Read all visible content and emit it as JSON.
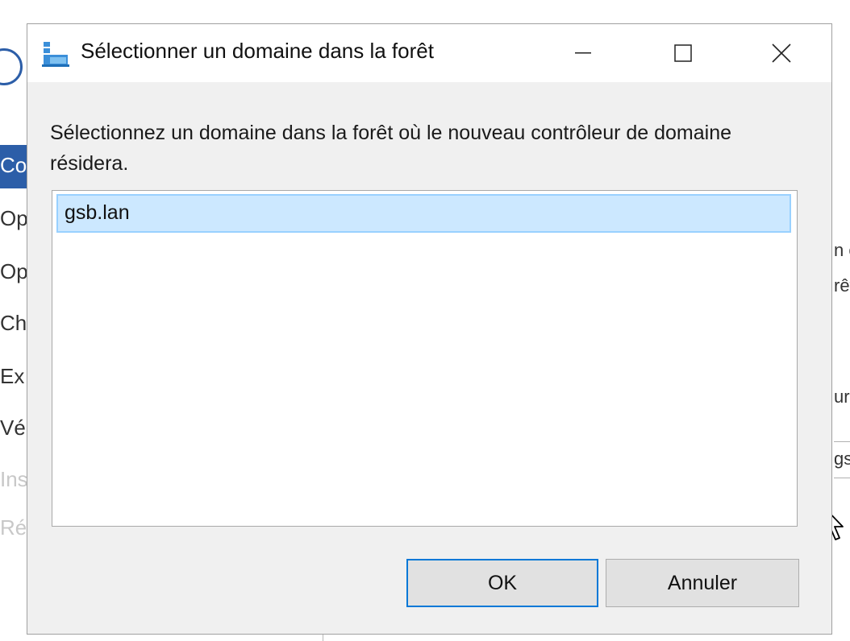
{
  "background": {
    "nav_items": [
      {
        "label": "Co"
      },
      {
        "label": "Op"
      },
      {
        "label": "Op"
      },
      {
        "label": "Ch"
      },
      {
        "label": "Ex"
      },
      {
        "label": "Vé"
      },
      {
        "label": "Ins"
      },
      {
        "label": "Ré"
      }
    ],
    "right_snippets": [
      "n c",
      "rêt",
      "ur",
      "gsl"
    ],
    "accent_color": "#2c5ea8"
  },
  "dialog": {
    "title": "Sélectionner un domaine dans la forêt",
    "icons": {
      "app": "domain-tree-icon",
      "minimize": "minimize-icon",
      "maximize": "maximize-icon",
      "close": "close-icon"
    },
    "instructions": "Sélectionnez un domaine dans la forêt où le nouveau contrôleur de domaine résidera.",
    "domains": [
      "gsb.lan"
    ],
    "selected_domain": "gsb.lan",
    "ok_label": "OK",
    "cancel_label": "Annuler",
    "selection_color": "#cce8ff",
    "focus_color": "#0078d7"
  }
}
